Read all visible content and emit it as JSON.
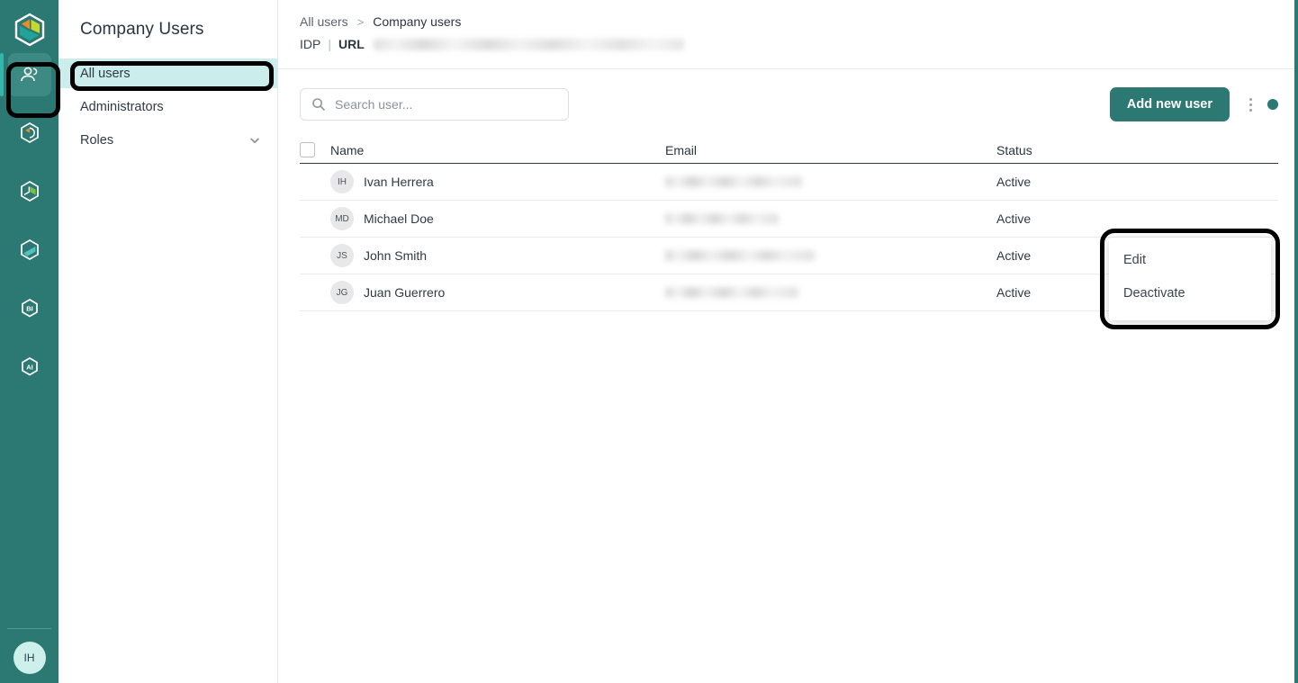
{
  "brand": {
    "accent_teal": "#2c7873",
    "accent_bright": "#35b5ad",
    "selected_bg": "#cbeeec",
    "logo_icon": "hexagon-logo-icon"
  },
  "rail": {
    "items": [
      {
        "icon": "users-hexagon-icon",
        "name": "rail-item-users",
        "active": true
      },
      {
        "icon": "pie-chart-orange-hexagon-icon",
        "name": "rail-item-reports",
        "active": false
      },
      {
        "icon": "pie-chart-green-hexagon-icon",
        "name": "rail-item-analytics",
        "active": false
      },
      {
        "icon": "slash-hexagon-icon",
        "name": "rail-item-data",
        "active": false
      },
      {
        "icon": "bi-hexagon-icon",
        "name": "rail-item-bi",
        "active": false,
        "label": "BI"
      },
      {
        "icon": "ai-hexagon-icon",
        "name": "rail-item-ai",
        "active": false,
        "label": "AI"
      }
    ],
    "avatar_initials": "IH"
  },
  "sidebar": {
    "title": "Company Users",
    "items": [
      {
        "label": "All users",
        "selected": true,
        "chevron": false
      },
      {
        "label": "Administrators",
        "selected": false,
        "chevron": false
      },
      {
        "label": "Roles",
        "selected": false,
        "chevron": true
      }
    ]
  },
  "breadcrumb": {
    "parent": "All users",
    "separator": ">",
    "current": "Company users"
  },
  "idp": {
    "idp_label": "IDP",
    "divider": "|",
    "url_label": "URL",
    "url_value": ""
  },
  "search": {
    "placeholder": "Search user...",
    "value": "",
    "icon": "search-icon"
  },
  "toolbar": {
    "add_user_label": "Add new user",
    "kebab_icon": "more-vertical-icon",
    "status_dot_icon": "status-dot-icon"
  },
  "table": {
    "columns": [
      "Name",
      "Email",
      "Status"
    ],
    "rows": [
      {
        "initials": "IH",
        "name": "Ivan Herrera",
        "email": "",
        "status": "Active"
      },
      {
        "initials": "MD",
        "name": "Michael Doe",
        "email": "",
        "status": "Active"
      },
      {
        "initials": "JS",
        "name": "John Smith",
        "email": "",
        "status": "Active"
      },
      {
        "initials": "JG",
        "name": "Juan Guerrero",
        "email": "",
        "status": "Active"
      }
    ]
  },
  "context_menu": {
    "items": [
      "Edit",
      "Deactivate"
    ]
  }
}
